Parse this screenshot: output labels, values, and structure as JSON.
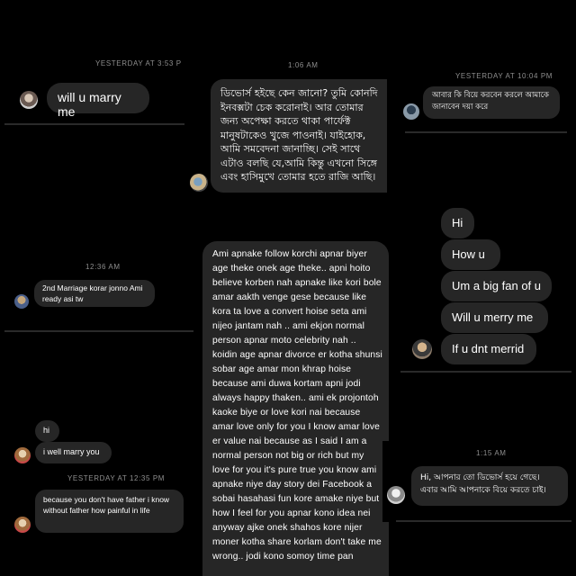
{
  "panel1": {
    "timestamp": "YESTERDAY AT 3:53 P",
    "message": "will u marry me"
  },
  "panel2": {
    "timestamp": "1:06 AM",
    "message": "ডিভোর্স হইছে কেন জানো? তুমি কোনদি ইনবক্সটা চেক করোনাই। আর তোমার জন্য অপেক্ষা করতে থাকা পার্ফেক্ট মানুষটাকেও খুজে পাওনাই। যাইহোক, আমি সমবেদনা জানাচ্ছি। সেই সাথে এটাও বলছি যে,আমি কিন্তু এখনো সিঙ্গে এবং হাসিমুখে তোমার হতে রাজি আছি।"
  },
  "panel3": {
    "timestamp": "YESTERDAY AT 10:04 PM",
    "message": "আবার কি বিয়ে করবেন করলে আমাকে জানাবেন দয়া করে"
  },
  "panel4": {
    "timestamp": "12:36 AM",
    "message": "2nd Marriage korar jonno Ami ready asi tw"
  },
  "panel5": {
    "message": "Ami apnake follow korchi apnar biyer age theke onek age theke.. apni hoito believe korben nah apnake like kori bole amar aakth venge gese because  like kora ta love a convert hoise seta ami nijeo jantam nah .. ami ekjon normal person apnar moto celebrity nah .. koidin age apnar divorce er kotha shunsi sobar age amar mon khrap hoise because ami duwa kortam apni jodi always happy thaken.. ami ek projontoh kaoke biye or love kori nai because amar love only for you I know amar love er value nai because as I said I am a normal person not big or rich but my love for you it's pure true you know ami apnake niye day story dei Facebook a sobai hasahasi fun kore amake niye but how I feel for you apnar kono idea nei anyway ajke onek shahos kore nijer moner kotha share korlam don't take me wrong.. jodi kono somoy time pan"
  },
  "panel6": {
    "messages": [
      "Hi",
      "How u",
      "Um a big fan of u",
      "Will u merry me",
      "If u dnt merrid"
    ]
  },
  "panel7": {
    "messages": [
      "hi",
      "i well marry you"
    ],
    "timestamp": "YESTERDAY AT 12:35 PM",
    "message2": "because you don't have father i know without father how painful in life"
  },
  "panel8": {
    "timestamp": "1:15 AM",
    "message": "Hi, আপনার তো ডিভোর্স হয়ে গেছে। এবার আমি আপনাকে বিয়ে করতে চাই।"
  },
  "colors": {
    "bubble": "#262626",
    "timestamp": "#8e8e8e",
    "background": "#000000"
  },
  "icons": {
    "avatar": "profile-avatar"
  }
}
